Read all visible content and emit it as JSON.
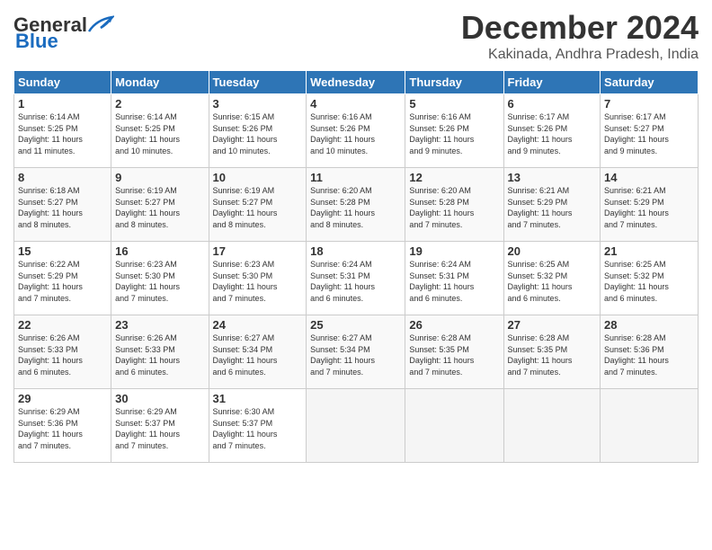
{
  "header": {
    "logo_line1": "General",
    "logo_line2": "Blue",
    "title": "December 2024",
    "subtitle": "Kakinada, Andhra Pradesh, India"
  },
  "weekdays": [
    "Sunday",
    "Monday",
    "Tuesday",
    "Wednesday",
    "Thursday",
    "Friday",
    "Saturday"
  ],
  "weeks": [
    [
      {
        "day": "1",
        "info": "Sunrise: 6:14 AM\nSunset: 5:25 PM\nDaylight: 11 hours\nand 11 minutes."
      },
      {
        "day": "2",
        "info": "Sunrise: 6:14 AM\nSunset: 5:25 PM\nDaylight: 11 hours\nand 10 minutes."
      },
      {
        "day": "3",
        "info": "Sunrise: 6:15 AM\nSunset: 5:26 PM\nDaylight: 11 hours\nand 10 minutes."
      },
      {
        "day": "4",
        "info": "Sunrise: 6:16 AM\nSunset: 5:26 PM\nDaylight: 11 hours\nand 10 minutes."
      },
      {
        "day": "5",
        "info": "Sunrise: 6:16 AM\nSunset: 5:26 PM\nDaylight: 11 hours\nand 9 minutes."
      },
      {
        "day": "6",
        "info": "Sunrise: 6:17 AM\nSunset: 5:26 PM\nDaylight: 11 hours\nand 9 minutes."
      },
      {
        "day": "7",
        "info": "Sunrise: 6:17 AM\nSunset: 5:27 PM\nDaylight: 11 hours\nand 9 minutes."
      }
    ],
    [
      {
        "day": "8",
        "info": "Sunrise: 6:18 AM\nSunset: 5:27 PM\nDaylight: 11 hours\nand 8 minutes."
      },
      {
        "day": "9",
        "info": "Sunrise: 6:19 AM\nSunset: 5:27 PM\nDaylight: 11 hours\nand 8 minutes."
      },
      {
        "day": "10",
        "info": "Sunrise: 6:19 AM\nSunset: 5:27 PM\nDaylight: 11 hours\nand 8 minutes."
      },
      {
        "day": "11",
        "info": "Sunrise: 6:20 AM\nSunset: 5:28 PM\nDaylight: 11 hours\nand 8 minutes."
      },
      {
        "day": "12",
        "info": "Sunrise: 6:20 AM\nSunset: 5:28 PM\nDaylight: 11 hours\nand 7 minutes."
      },
      {
        "day": "13",
        "info": "Sunrise: 6:21 AM\nSunset: 5:29 PM\nDaylight: 11 hours\nand 7 minutes."
      },
      {
        "day": "14",
        "info": "Sunrise: 6:21 AM\nSunset: 5:29 PM\nDaylight: 11 hours\nand 7 minutes."
      }
    ],
    [
      {
        "day": "15",
        "info": "Sunrise: 6:22 AM\nSunset: 5:29 PM\nDaylight: 11 hours\nand 7 minutes."
      },
      {
        "day": "16",
        "info": "Sunrise: 6:23 AM\nSunset: 5:30 PM\nDaylight: 11 hours\nand 7 minutes."
      },
      {
        "day": "17",
        "info": "Sunrise: 6:23 AM\nSunset: 5:30 PM\nDaylight: 11 hours\nand 7 minutes."
      },
      {
        "day": "18",
        "info": "Sunrise: 6:24 AM\nSunset: 5:31 PM\nDaylight: 11 hours\nand 6 minutes."
      },
      {
        "day": "19",
        "info": "Sunrise: 6:24 AM\nSunset: 5:31 PM\nDaylight: 11 hours\nand 6 minutes."
      },
      {
        "day": "20",
        "info": "Sunrise: 6:25 AM\nSunset: 5:32 PM\nDaylight: 11 hours\nand 6 minutes."
      },
      {
        "day": "21",
        "info": "Sunrise: 6:25 AM\nSunset: 5:32 PM\nDaylight: 11 hours\nand 6 minutes."
      }
    ],
    [
      {
        "day": "22",
        "info": "Sunrise: 6:26 AM\nSunset: 5:33 PM\nDaylight: 11 hours\nand 6 minutes."
      },
      {
        "day": "23",
        "info": "Sunrise: 6:26 AM\nSunset: 5:33 PM\nDaylight: 11 hours\nand 6 minutes."
      },
      {
        "day": "24",
        "info": "Sunrise: 6:27 AM\nSunset: 5:34 PM\nDaylight: 11 hours\nand 6 minutes."
      },
      {
        "day": "25",
        "info": "Sunrise: 6:27 AM\nSunset: 5:34 PM\nDaylight: 11 hours\nand 7 minutes."
      },
      {
        "day": "26",
        "info": "Sunrise: 6:28 AM\nSunset: 5:35 PM\nDaylight: 11 hours\nand 7 minutes."
      },
      {
        "day": "27",
        "info": "Sunrise: 6:28 AM\nSunset: 5:35 PM\nDaylight: 11 hours\nand 7 minutes."
      },
      {
        "day": "28",
        "info": "Sunrise: 6:28 AM\nSunset: 5:36 PM\nDaylight: 11 hours\nand 7 minutes."
      }
    ],
    [
      {
        "day": "29",
        "info": "Sunrise: 6:29 AM\nSunset: 5:36 PM\nDaylight: 11 hours\nand 7 minutes."
      },
      {
        "day": "30",
        "info": "Sunrise: 6:29 AM\nSunset: 5:37 PM\nDaylight: 11 hours\nand 7 minutes."
      },
      {
        "day": "31",
        "info": "Sunrise: 6:30 AM\nSunset: 5:37 PM\nDaylight: 11 hours\nand 7 minutes."
      },
      {
        "day": "",
        "info": ""
      },
      {
        "day": "",
        "info": ""
      },
      {
        "day": "",
        "info": ""
      },
      {
        "day": "",
        "info": ""
      }
    ]
  ],
  "colors": {
    "header_bg": "#2e75b6",
    "logo_blue": "#1a6bbf"
  }
}
